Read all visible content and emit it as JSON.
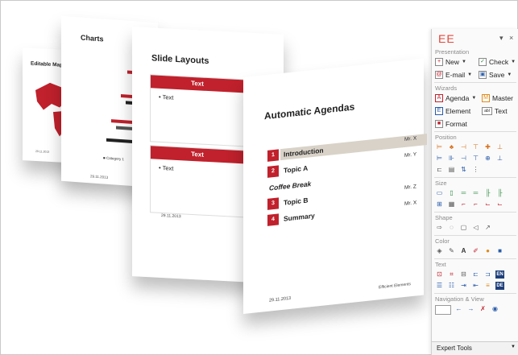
{
  "slides": {
    "maps": {
      "title": "Editable Maps",
      "date": "29.11.2013"
    },
    "charts": {
      "title": "Charts",
      "legend": "Category 1",
      "date": "29.11.2013"
    },
    "layouts": {
      "title": "Slide Layouts",
      "box1_head": "Text",
      "box1_text": "Text",
      "box2_head": "Text",
      "box2_text": "Text",
      "date": "29.11.2013"
    },
    "agenda": {
      "title": "Automatic Agendas",
      "items": [
        {
          "num": "1",
          "label": "Introduction",
          "who": "Mr. X"
        },
        {
          "num": "2",
          "label": "Topic A",
          "who": "Mr. Y"
        },
        {
          "num": "",
          "label": "Coffee Break",
          "who": ""
        },
        {
          "num": "3",
          "label": "Topic B",
          "who": "Mr. Z"
        },
        {
          "num": "4",
          "label": "Summary",
          "who": "Mr. X"
        }
      ],
      "date": "29.11.2013",
      "footer": "Efficient Elements"
    }
  },
  "panel": {
    "logo": "EE",
    "pin": "▾",
    "close": "×",
    "sections": {
      "presentation": "Presentation",
      "wizards": "Wizards",
      "position": "Position",
      "size": "Size",
      "shape": "Shape",
      "color": "Color",
      "text": "Text",
      "navigation": "Navigation & View"
    },
    "presentation": {
      "new": "New",
      "check": "Check",
      "email": "E-mail",
      "save": "Save"
    },
    "wizards": {
      "agenda": "Agenda",
      "master": "Master",
      "element": "Element",
      "text": "Text",
      "format": "Format"
    },
    "text_badges": {
      "en": "EN",
      "de": "DE"
    },
    "expert_tools": "Expert Tools"
  }
}
